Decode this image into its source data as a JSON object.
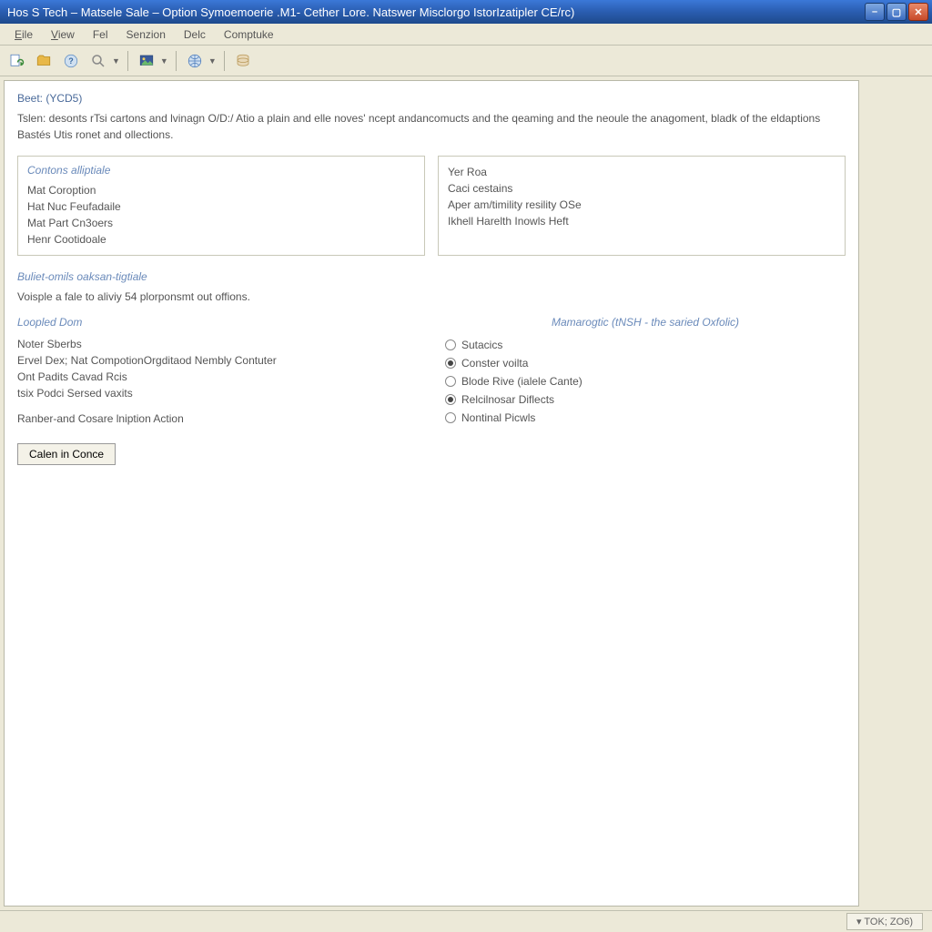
{
  "window": {
    "title": "Hos S Tech – Matsele Sale – Option Symoemoerie .M1- Cether Lore. Natswer Misclorgo IstorIzatipler CE/rc)"
  },
  "menu": {
    "items": [
      {
        "label": "Eile",
        "ul": "E",
        "rest": "ile"
      },
      {
        "label": "View",
        "ul": "V",
        "rest": "iew"
      },
      {
        "label": "Fel",
        "ul": "",
        "rest": "Fel"
      },
      {
        "label": "Senzion",
        "ul": "",
        "rest": "Senzion"
      },
      {
        "label": "Delc",
        "ul": "",
        "rest": "Delc"
      },
      {
        "label": "Comptuke",
        "ul": "",
        "rest": "Comptuke"
      }
    ]
  },
  "toolbar_icons": [
    "doc-refresh",
    "folder",
    "help",
    "search",
    "dropdown1",
    "image",
    "dropdown2",
    "globe",
    "dropdown3",
    "db"
  ],
  "content": {
    "header": "Beet: (YCD5)",
    "description": "Tslen: desonts rTsi cartons and lvinagn O/D:/ Atio a plain and elle noves' ncept andancomucts and the qeaming and the neoule the anagoment, bladk of the eldaptions Bastés Utis ronet and ollections.",
    "box_left": {
      "title": "Contons alliptiale",
      "items": [
        "Mat Coroption",
        "Hat Nuc Feufadaile",
        "Mat Part Cn3oers",
        "Henr Cootidoale"
      ]
    },
    "box_right": {
      "items": [
        "Yer Roa",
        "Caci cestains",
        "Aper am/timility resility OSe",
        "Ikhell Harelth Inowls Heft"
      ]
    },
    "sub_title": "Buliet-omils oaksan-tigtiale",
    "sub_desc": "Voisple a fale to aliviy 54 plorponsmt out offions.",
    "col_left": {
      "title": "Loopled Dom",
      "items": [
        "Noter Sberbs",
        "Ervel Dex; Nat CompotionOrgditaod Nembly Contuter",
        "Ont Padits Cavad Rcis",
        "tsix Podci Sersed vaxits",
        "Ranber-and Cosare lniption Action"
      ]
    },
    "col_right": {
      "title": "Mamarogtic (tNSH - the saried Oxfolic)",
      "options": [
        {
          "label": "Sutacics",
          "selected": false
        },
        {
          "label": "Conster voilta",
          "selected": true
        },
        {
          "label": "Blode Rive (ialele Cante)",
          "selected": false
        },
        {
          "label": "Relcilnosar Diflects",
          "selected": true
        },
        {
          "label": "Nontinal Picwls",
          "selected": false
        }
      ]
    },
    "button": "Calen in Conce"
  },
  "status": {
    "cell": "▾ TOK; ZO6)"
  }
}
